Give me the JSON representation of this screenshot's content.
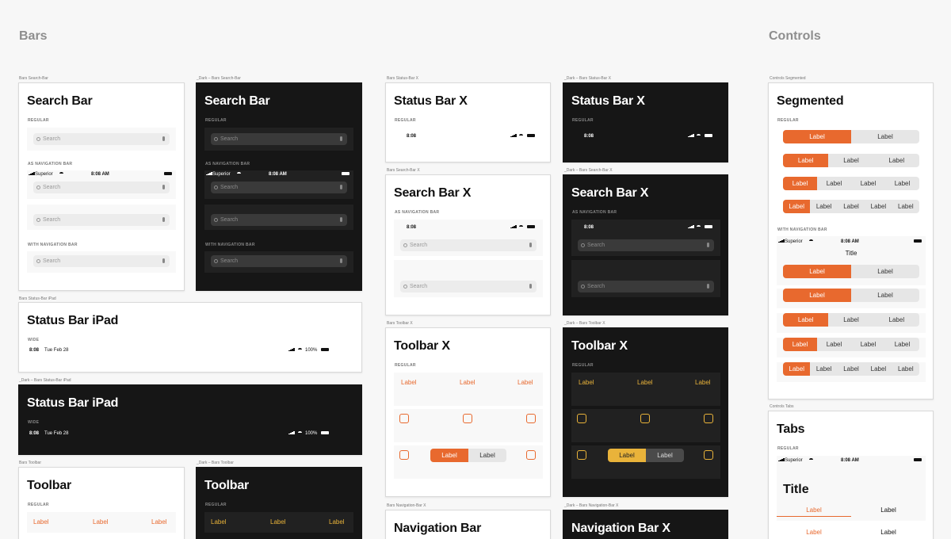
{
  "sections": {
    "bars": "Bars",
    "controls": "Controls"
  },
  "search_label": "Search",
  "status": {
    "carrier": "Superior",
    "time_full": "8:08 AM",
    "time": "8:08",
    "ipad_date": "Tue Feb 28",
    "battery_pct": "100%"
  },
  "seg_label": "Label",
  "captions": {
    "search_bar": "Bars Search-Bar",
    "search_bar_dark": "_Dark – Bars Search-Bar",
    "status_bar_x": "Bars Status-Bar X",
    "status_bar_x_dark": "_Dark – Bars Status-Bar X",
    "search_bar_x": "Bars Search-Bar X",
    "search_bar_x_dark": "_Dark – Bars Search-Bar X",
    "status_ipad": "Bars Status-Bar iPad",
    "status_ipad_dark": "_Dark – Bars Status-Bar iPad",
    "toolbar_x": "Bars Toolbar X",
    "toolbar_x_dark": "_Dark – Bars Toolbar X",
    "toolbar": "Bars Toolbar",
    "toolbar_dark": "_Dark – Bars Toolbar",
    "nav_x": "Bars Navigation-Bar X",
    "nav_x_dark": "_Dark – Bars Navigation-Bar X",
    "segmented": "Controls Segmented",
    "tabs": "Controls Tabs"
  },
  "titles": {
    "search_bar": "Search Bar",
    "status_bar_x": "Status Bar X",
    "search_bar_x": "Search Bar X",
    "status_ipad": "Status Bar iPad",
    "toolbar_x": "Toolbar X",
    "toolbar": "Toolbar",
    "nav_bar": "Navigation Bar",
    "nav_bar_x": "Navigation Bar X",
    "segmented": "Segmented",
    "tabs": "Tabs",
    "title": "Title"
  },
  "labels": {
    "regular": "REGULAR",
    "as_nav": "AS NAVIGATION BAR",
    "with_nav": "WITH NAVIGATION BAR",
    "wide": "WIDE"
  }
}
